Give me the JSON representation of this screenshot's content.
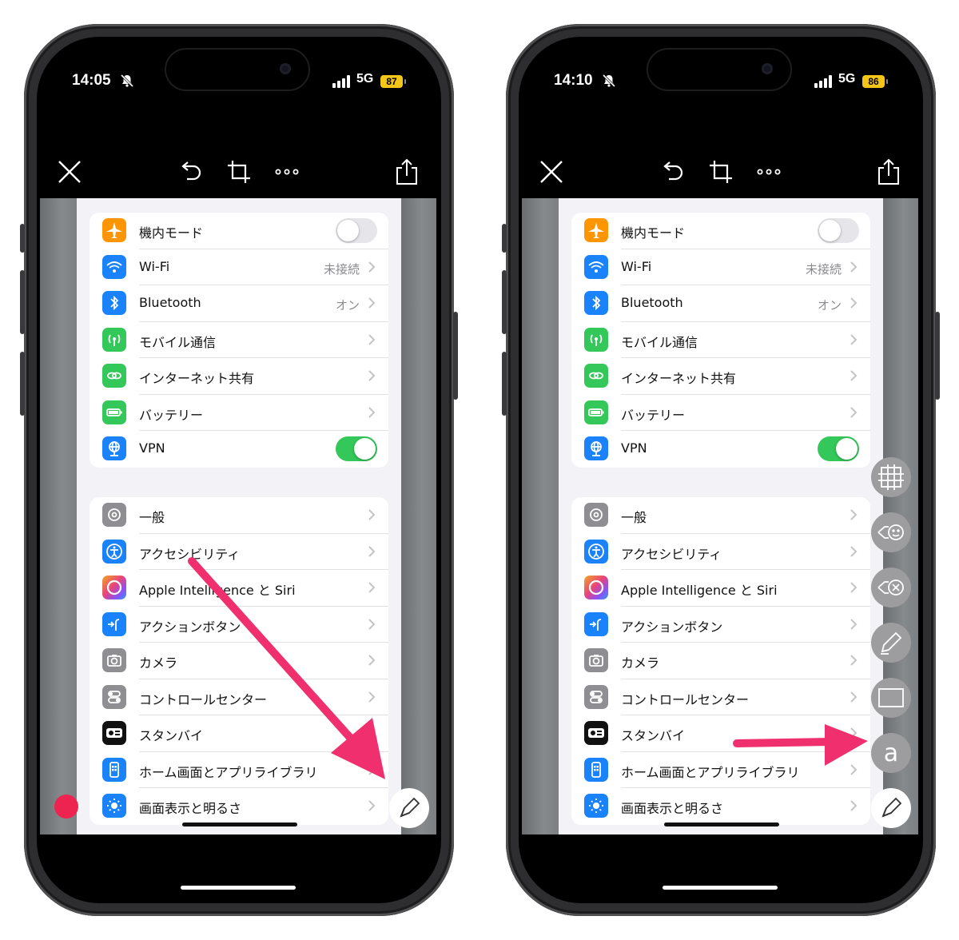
{
  "phones": [
    {
      "status": {
        "time": "14:05",
        "network": "5G",
        "battery": "87"
      }
    },
    {
      "status": {
        "time": "14:10",
        "network": "5G",
        "battery": "86"
      }
    }
  ],
  "colors": {
    "accent_arrow": "#f0306e",
    "toggle_on": "#34c759",
    "toggle_off": "#e5e5ea"
  },
  "settings_group1": [
    {
      "label": "機内モード",
      "icon": "airplane-icon",
      "color": "#ff9500",
      "toggle": false
    },
    {
      "label": "Wi-Fi",
      "icon": "wifi-icon",
      "color": "#1a82fb",
      "value": "未接続"
    },
    {
      "label": "Bluetooth",
      "icon": "bluetooth-icon",
      "color": "#1a82fb",
      "value": "オン"
    },
    {
      "label": "モバイル通信",
      "icon": "antenna-icon",
      "color": "#34c759"
    },
    {
      "label": "インターネット共有",
      "icon": "link-icon",
      "color": "#34c759"
    },
    {
      "label": "バッテリー",
      "icon": "battery-icon",
      "color": "#34c759"
    },
    {
      "label": "VPN",
      "icon": "globe-icon",
      "color": "#1a82fb",
      "toggle": true
    }
  ],
  "settings_group2": [
    {
      "label": "一般",
      "icon": "gear-icon",
      "color": "#8e8e93"
    },
    {
      "label": "アクセシビリティ",
      "icon": "accessibility-icon",
      "color": "#1a82fb"
    },
    {
      "label": "Apple Intelligence と Siri",
      "icon": "siri-icon",
      "color": "#c45cf2"
    },
    {
      "label": "アクションボタン",
      "icon": "action-button-icon",
      "color": "#1a82fb"
    },
    {
      "label": "カメラ",
      "icon": "camera-icon",
      "color": "#8e8e93"
    },
    {
      "label": "コントロールセンター",
      "icon": "control-center-icon",
      "color": "#8e8e93"
    },
    {
      "label": "スタンバイ",
      "icon": "standby-icon",
      "color": "#111111"
    },
    {
      "label": "ホーム画面とアプリライブラリ",
      "icon": "home-screen-icon",
      "color": "#1a82fb"
    },
    {
      "label": "画面表示と明るさ",
      "icon": "sun-icon",
      "color": "#1a82fb"
    }
  ],
  "toolbar_icons": [
    "close-icon",
    "undo-icon",
    "crop-icon",
    "more-icon",
    "share-icon"
  ],
  "right_tools": [
    "mosaic-icon",
    "sticker-icon",
    "eraser-icon",
    "marker-icon",
    "rectangle-icon",
    "text-icon"
  ]
}
